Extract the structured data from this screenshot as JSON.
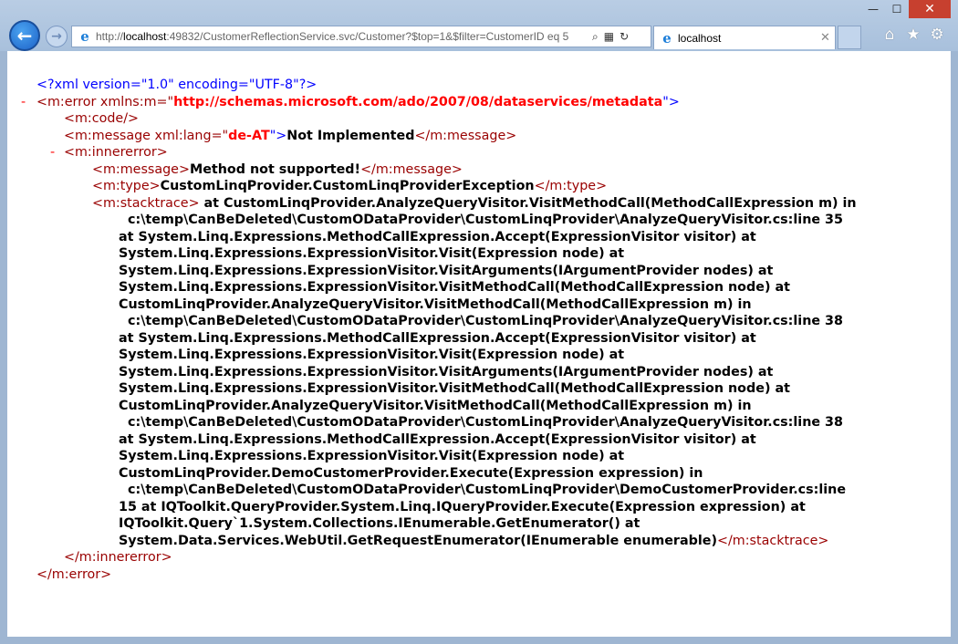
{
  "window": {
    "minimize": "—",
    "maximize": "☐",
    "close": "✕"
  },
  "nav": {
    "back_icon": "back-arrow-icon",
    "forward_icon": "forward-arrow-icon"
  },
  "address": {
    "scheme": "http://",
    "host": "localhost",
    "rest": ":49832/CustomerReflectionService.svc/Customer?$top=1&$filter=CustomerID eq 5",
    "search_icon": "⌕",
    "compat_icon": "▦",
    "refresh_icon": "↻"
  },
  "tab": {
    "title": "localhost",
    "close": "✕"
  },
  "tools": {
    "home": "⌂",
    "favorites": "★",
    "settings": "⚙"
  },
  "xml": {
    "decl": "<?xml version=\"1.0\" encoding=\"UTF-8\"?>",
    "collapse": "-",
    "error_open_start": "<m:error xmlns:m=\"",
    "ns_value": "http://schemas.microsoft.com/ado/2007/08/dataservices/metadata",
    "error_open_end": "\">",
    "code_empty": "<m:code/>",
    "msg_open_start": "<m:message xml:lang=\"",
    "lang_value": "de-AT",
    "msg_open_end": "\">",
    "msg_text": "Not Implemented",
    "msg_close": "</m:message>",
    "inner_open": "<m:innererror>",
    "inner_msg_open": "<m:message>",
    "inner_msg_text": "Method not supported!",
    "inner_msg_close": "</m:message>",
    "type_open": "<m:type>",
    "type_text": "CustomLinqProvider.CustomLinqProviderException",
    "type_close": "</m:type>",
    "stack_open": "<m:stacktrace>",
    "stack_first": " at CustomLinqProvider.AnalyzeQueryVisitor.VisitMethodCall(MethodCallExpression m) in",
    "stack_lines": [
      "c:\\temp\\CanBeDeleted\\CustomODataProvider\\CustomLinqProvider\\AnalyzeQueryVisitor.cs:line 35",
      "at System.Linq.Expressions.MethodCallExpression.Accept(ExpressionVisitor visitor) at",
      "System.Linq.Expressions.ExpressionVisitor.Visit(Expression node) at",
      "System.Linq.Expressions.ExpressionVisitor.VisitArguments(IArgumentProvider nodes) at",
      "System.Linq.Expressions.ExpressionVisitor.VisitMethodCall(MethodCallExpression node) at",
      "CustomLinqProvider.AnalyzeQueryVisitor.VisitMethodCall(MethodCallExpression m) in",
      "c:\\temp\\CanBeDeleted\\CustomODataProvider\\CustomLinqProvider\\AnalyzeQueryVisitor.cs:line 38",
      "at System.Linq.Expressions.MethodCallExpression.Accept(ExpressionVisitor visitor) at",
      "System.Linq.Expressions.ExpressionVisitor.Visit(Expression node) at",
      "System.Linq.Expressions.ExpressionVisitor.VisitArguments(IArgumentProvider nodes) at",
      "System.Linq.Expressions.ExpressionVisitor.VisitMethodCall(MethodCallExpression node) at",
      "CustomLinqProvider.AnalyzeQueryVisitor.VisitMethodCall(MethodCallExpression m) in",
      "c:\\temp\\CanBeDeleted\\CustomODataProvider\\CustomLinqProvider\\AnalyzeQueryVisitor.cs:line 38",
      "at System.Linq.Expressions.MethodCallExpression.Accept(ExpressionVisitor visitor) at",
      "System.Linq.Expressions.ExpressionVisitor.Visit(Expression node) at",
      "CustomLinqProvider.DemoCustomerProvider.Execute(Expression expression) in",
      "c:\\temp\\CanBeDeleted\\CustomODataProvider\\CustomLinqProvider\\DemoCustomerProvider.cs:line",
      "15 at IQToolkit.QueryProvider.System.Linq.IQueryProvider.Execute(Expression expression) at",
      "IQToolkit.Query`1.System.Collections.IEnumerable.GetEnumerator() at"
    ],
    "stack_last": "System.Data.Services.WebUtil.GetRequestEnumerator(IEnumerable enumerable)",
    "stack_close": "</m:stacktrace>",
    "inner_close": "</m:innererror>",
    "error_close": "</m:error>"
  }
}
